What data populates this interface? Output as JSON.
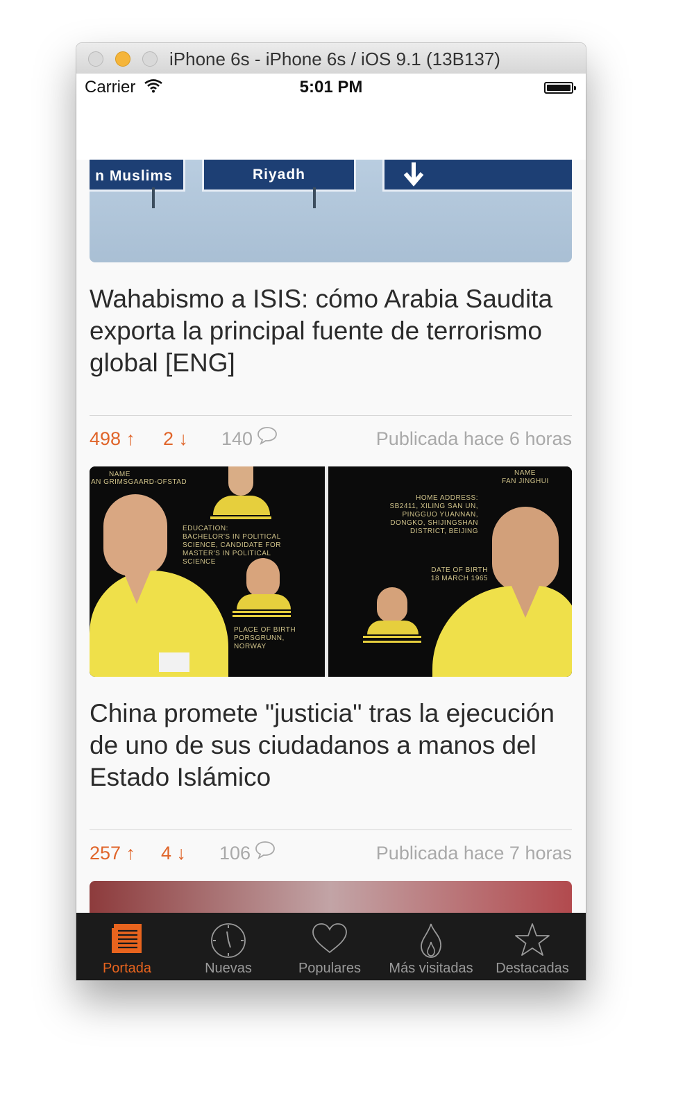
{
  "window": {
    "title": "iPhone 6s - iPhone 6s / iOS 9.1 (13B137)"
  },
  "status_bar": {
    "carrier": "Carrier",
    "time": "5:01 PM"
  },
  "articles": [
    {
      "image_sign_texts": [
        "n Muslims",
        "Riyadh"
      ],
      "title": "Wahabismo a ISIS: cómo Arabia Saudita exporta la principal fuente de terrorismo global [ENG]",
      "votes_up": "498 ↑",
      "votes_down": "2 ↓",
      "comments": "140",
      "published": "Publicada hace 6 horas"
    },
    {
      "image_texts": {
        "left_name_label": "NAME",
        "left_name": "AN GRIMSGAARD-OFSTAD",
        "education_label": "EDUCATION:",
        "education": "BACHELOR'S IN POLITICAL SCIENCE, CANDIDATE FOR MASTER'S IN POLITICAL SCIENCE",
        "birthplace_label": "PLACE OF BIRTH",
        "birthplace": "PORSGRUNN, NORWAY",
        "right_name_label": "NAME",
        "right_name": "FAN JINGHUI",
        "address_label": "HOME ADDRESS:",
        "address": "SB2411, XILING SAN UN, PINGGUO YUANNAN, DONGKO, SHIJINGSHAN DISTRICT, BEIJING",
        "dob_label": "DATE OF BIRTH",
        "dob": "18 MARCH 1965"
      },
      "title": "China promete \"justicia\" tras la ejecución de uno de sus ciudadanos a manos del Estado Islámico",
      "votes_up": "257 ↑",
      "votes_down": "4 ↓",
      "comments": "106",
      "published": "Publicada hace 7 horas"
    }
  ],
  "tab_bar": {
    "active_color": "#e8641e",
    "tabs": [
      {
        "label": "Portada",
        "icon": "newspaper-icon"
      },
      {
        "label": "Nuevas",
        "icon": "clock-icon"
      },
      {
        "label": "Populares",
        "icon": "heart-icon"
      },
      {
        "label": "Más visitadas",
        "icon": "flame-icon"
      },
      {
        "label": "Destacadas",
        "icon": "star-icon"
      }
    ]
  }
}
